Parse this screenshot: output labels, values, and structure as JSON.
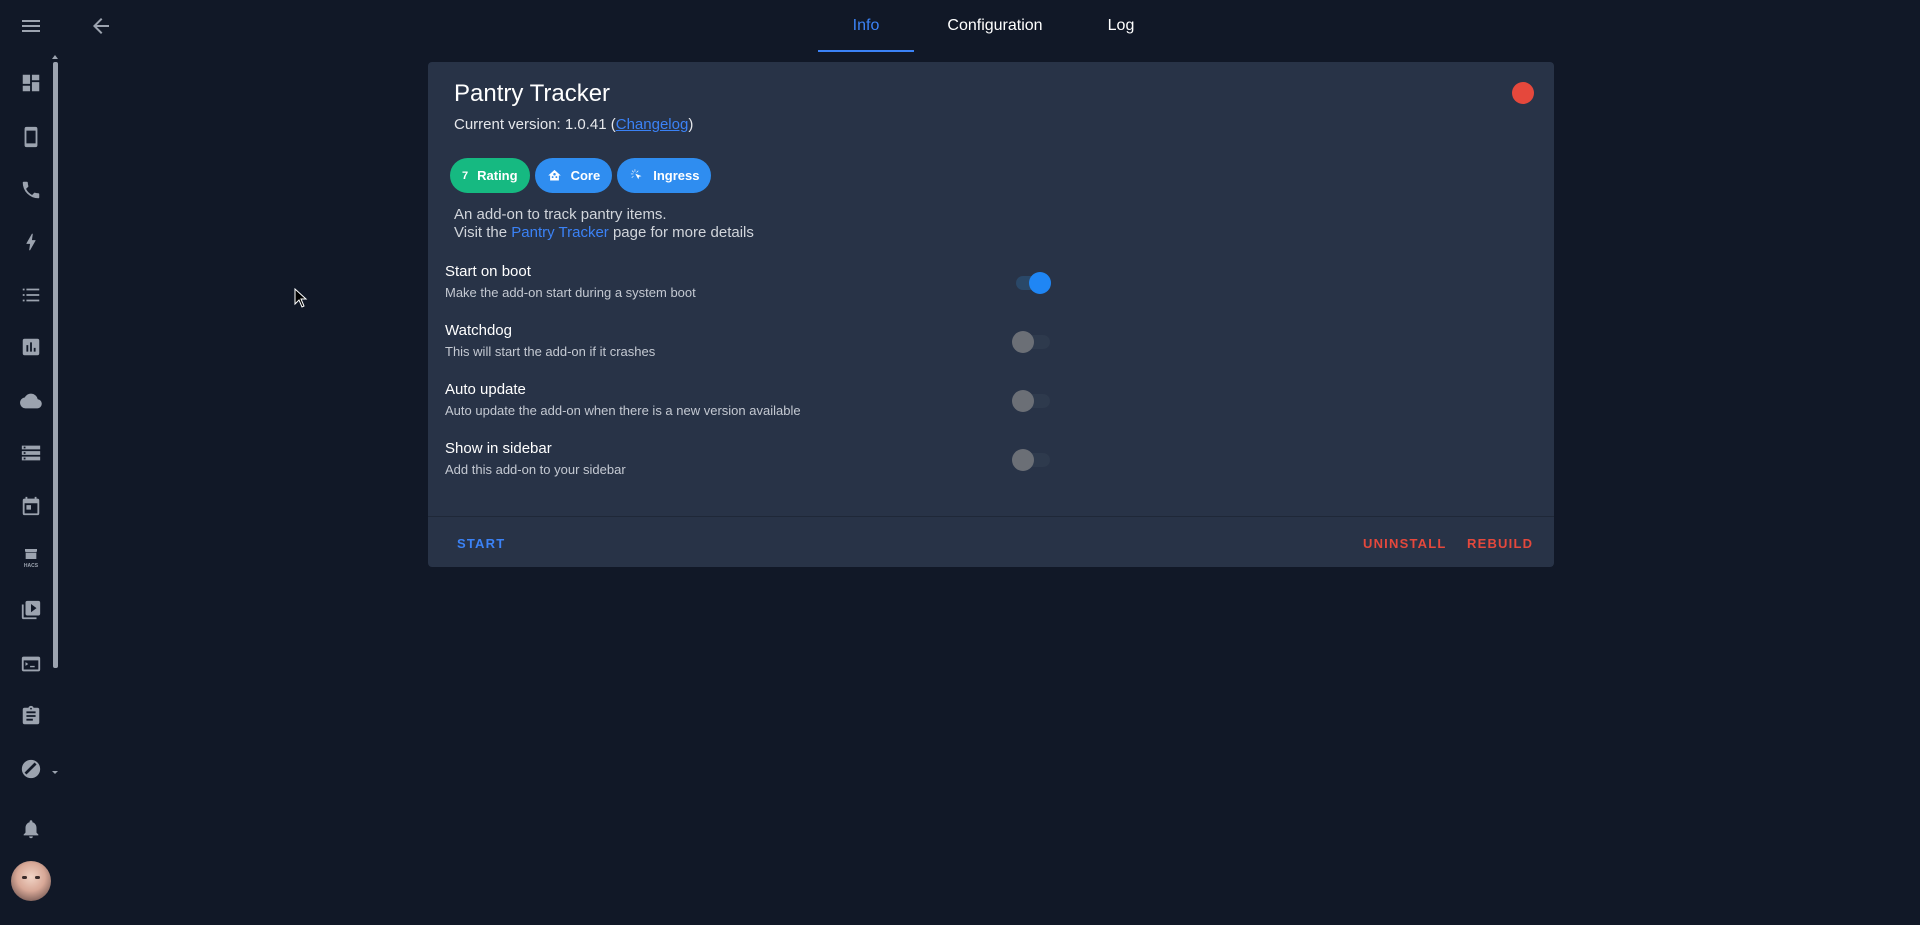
{
  "tabs": [
    {
      "label": "Info",
      "active": true
    },
    {
      "label": "Configuration",
      "active": false
    },
    {
      "label": "Log",
      "active": false
    }
  ],
  "sidebar": {
    "icons": [
      "dashboard-icon",
      "tablet-icon",
      "phone-icon",
      "lightning-icon",
      "list-icon",
      "chart-icon",
      "cloud-icon",
      "server-icon",
      "calendar-icon",
      "hacs-icon",
      "media-icon",
      "terminal-icon",
      "clipboard-icon",
      "developer-tools-icon",
      "bell-icon"
    ],
    "hacs_label": "HACS"
  },
  "addon": {
    "name": "Pantry Tracker",
    "version_prefix": "Current version: 1.0.41 (",
    "changelog_label": "Changelog",
    "version_suffix": ")",
    "status_color": "#e5483c",
    "badges": {
      "rating_value": "7",
      "rating_label": "Rating",
      "core_label": "Core",
      "ingress_label": "Ingress"
    },
    "description_line1": "An add-on to track pantry items.",
    "visit_prefix": "Visit the ",
    "visit_link": "Pantry Tracker",
    "visit_suffix": " page for more details"
  },
  "options": [
    {
      "title": "Start on boot",
      "subtitle": "Make the add-on start during a system boot",
      "enabled": true
    },
    {
      "title": "Watchdog",
      "subtitle": "This will start the add-on if it crashes",
      "enabled": false
    },
    {
      "title": "Auto update",
      "subtitle": "Auto update the add-on when there is a new version available",
      "enabled": false
    },
    {
      "title": "Show in sidebar",
      "subtitle": "Add this add-on to your sidebar",
      "enabled": false
    }
  ],
  "actions": {
    "start": "START",
    "uninstall": "UNINSTALL",
    "rebuild": "REBUILD"
  },
  "colors": {
    "accent": "#3b82f6",
    "danger": "#e5483c",
    "rating_badge": "#16b981",
    "background": "#111827",
    "card": "#283347"
  }
}
